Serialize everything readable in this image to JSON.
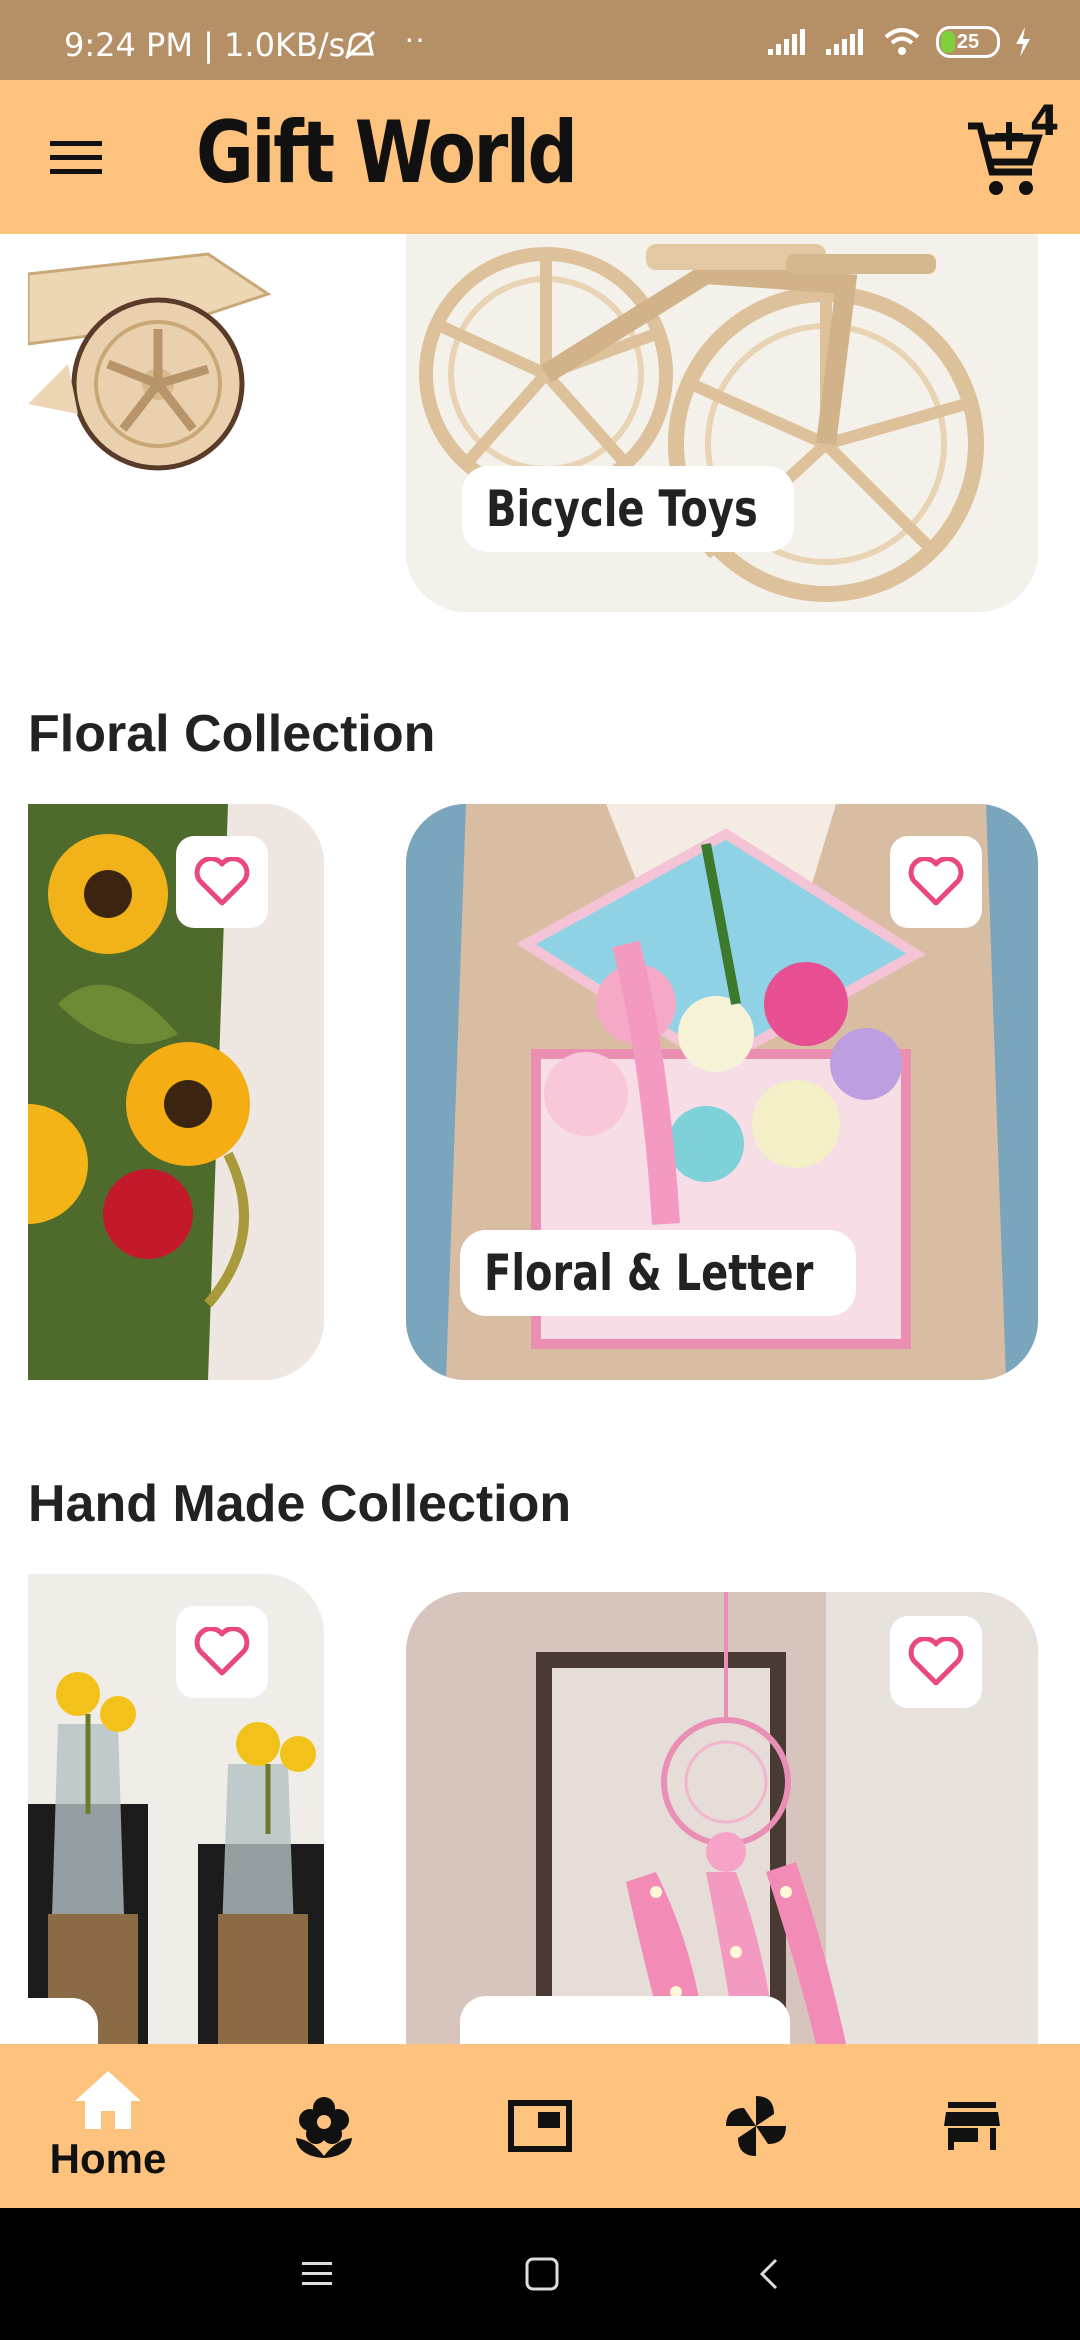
{
  "status_bar": {
    "time": "9:24 PM | 1.0KB/s",
    "battery": "25"
  },
  "app_bar": {
    "title": "Gift World",
    "cart_count": "4",
    "menu_icon": "hamburger-menu-icon",
    "cart_icon": "add-shopping-cart-icon"
  },
  "sections": {
    "top_card_label": "Bicycle Toys",
    "floral": {
      "title": "Floral Collection",
      "card_label": "Floral & Letter"
    },
    "handmade": {
      "title": "Hand Made Collection"
    }
  },
  "bottom_nav": {
    "items": [
      {
        "label": "Home",
        "icon": "home-icon",
        "active": true
      },
      {
        "label": "",
        "icon": "flower-icon"
      },
      {
        "label": "",
        "icon": "picture-in-picture-icon"
      },
      {
        "label": "",
        "icon": "pinwheel-icon"
      },
      {
        "label": "",
        "icon": "store-icon"
      }
    ]
  },
  "colors": {
    "app_bar": "#fdc27d",
    "status_bar": "#b59067",
    "heart": "#e8487e"
  }
}
